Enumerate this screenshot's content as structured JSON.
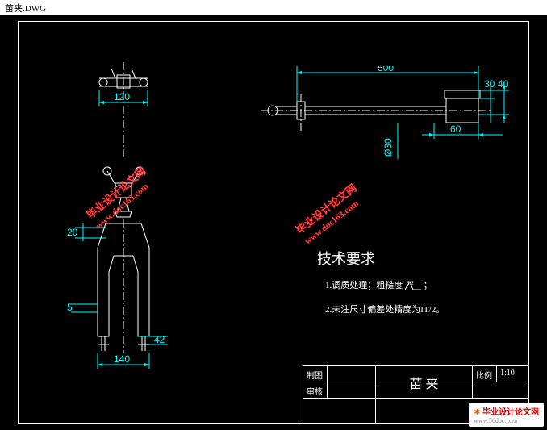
{
  "titlebar": {
    "filename": "苗夹.DWG"
  },
  "dims": {
    "d120": "120",
    "d20": "20",
    "d5": "5",
    "d140": "140",
    "d42": "42",
    "d500": "500",
    "d40": "40",
    "d30": "30",
    "d60": "60",
    "dia30": "Ø30"
  },
  "tech": {
    "title": "技术要求",
    "line1": "1.调质处理；粗糙度",
    "line1_sym": "3.2",
    "line1_end": "；",
    "line2": "2.未注尺寸偏差处精度为IT/2。"
  },
  "title_block": {
    "row1_label": "制图",
    "row2_label": "审核",
    "part_name": "苗 夹",
    "scale_label": "比例",
    "scale_value": "1:10"
  },
  "watermark": {
    "text1": "毕业设计论文网",
    "text2": "www.doc163.com"
  },
  "logo": {
    "line1": "毕业设计论文网",
    "line2": "www.56doc.com"
  }
}
